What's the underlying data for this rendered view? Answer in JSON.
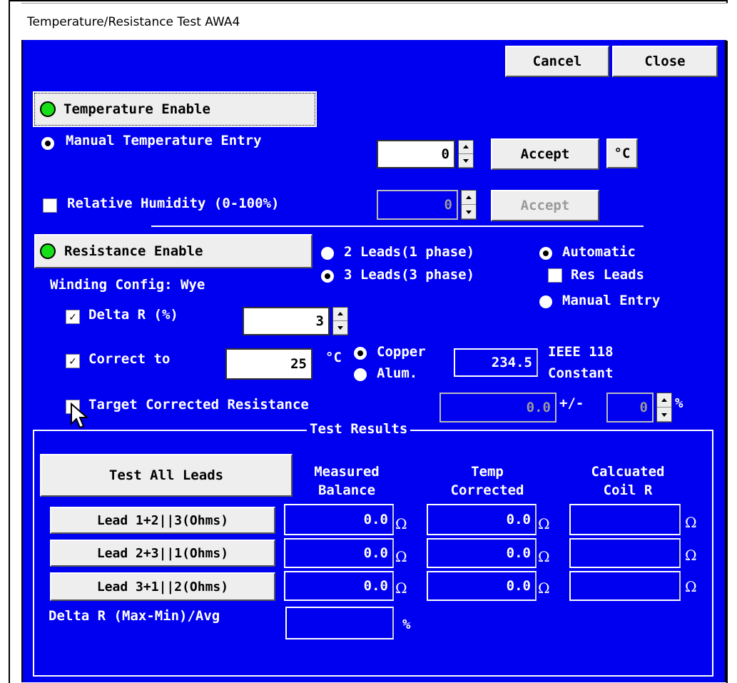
{
  "window": {
    "title": "Temperature/Resistance Test  AWA4"
  },
  "toolbar": {
    "cancel_label": "Cancel",
    "close_label": "Close"
  },
  "temperature": {
    "enable_label": "Temperature Enable",
    "manual_label": "Manual Temperature Entry",
    "value": "0",
    "accept_label": "Accept",
    "unit_label": "°C"
  },
  "humidity": {
    "label": "Relative Humidity (0-100%)",
    "value": "0",
    "accept_label": "Accept"
  },
  "resistance": {
    "enable_label": "Resistance Enable",
    "leads2_label": "2 Leads(1 phase)",
    "leads3_label": "3 Leads(3 phase)",
    "automatic_label": "Automatic",
    "res_leads_label": "Res Leads",
    "manual_entry_label": "Manual Entry",
    "winding_label": "Winding Config:",
    "winding_value": "Wye",
    "delta_r_label": "Delta R (%)",
    "delta_r_value": "3",
    "correct_to_label": "Correct to",
    "correct_to_value": "25",
    "correct_unit": "°C",
    "copper_label": "Copper",
    "alum_label": "Alum.",
    "constant_value": "234.5",
    "ieee_label": "IEEE 118",
    "constant_label": "Constant",
    "target_label": "Target Corrected Resistance",
    "target_value": "0.0",
    "plusminus": "+/-",
    "tolerance_value": "0",
    "percent": "%"
  },
  "results": {
    "group_label": "Test Results",
    "test_all_label": "Test All Leads",
    "col_measured": "Measured Balance",
    "col_temp": "Temp Corrected",
    "col_coil": "Calcuated Coil R",
    "ohm": "Ω",
    "rows": [
      {
        "label": "Lead 1+2||3(Ohms)",
        "measured": "0.0",
        "corrected": "0.0",
        "coil": ""
      },
      {
        "label": "Lead 2+3||1(Ohms)",
        "measured": "0.0",
        "corrected": "0.0",
        "coil": ""
      },
      {
        "label": "Lead 3+1||2(Ohms)",
        "measured": "0.0",
        "corrected": "0.0",
        "coil": ""
      }
    ],
    "delta_label": "Delta R (Max-Min)/Avg",
    "delta_value": "",
    "delta_unit": "%"
  }
}
